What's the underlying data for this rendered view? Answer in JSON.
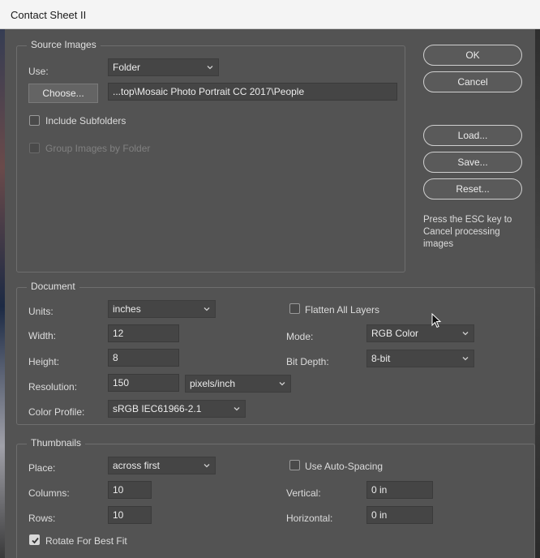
{
  "window": {
    "title": "Contact Sheet II"
  },
  "source_images": {
    "legend": "Source Images",
    "use_label": "Use:",
    "use_value": "Folder",
    "choose_button": "Choose...",
    "path": "...top\\Mosaic Photo Portrait CC 2017\\People",
    "include_subfolders": {
      "label": "Include Subfolders",
      "checked": false
    },
    "group_by_folder": {
      "label": "Group Images by Folder",
      "checked": false,
      "enabled": false
    }
  },
  "buttons": {
    "ok": "OK",
    "cancel": "Cancel",
    "load": "Load...",
    "save": "Save...",
    "reset": "Reset...",
    "note": "Press the ESC key to Cancel processing images"
  },
  "document": {
    "legend": "Document",
    "units_label": "Units:",
    "units_value": "inches",
    "flatten": {
      "label": "Flatten All Layers",
      "checked": false
    },
    "width_label": "Width:",
    "width_value": "12",
    "height_label": "Height:",
    "height_value": "8",
    "resolution_label": "Resolution:",
    "resolution_value": "150",
    "resolution_unit": "pixels/inch",
    "mode_label": "Mode:",
    "mode_value": "RGB Color",
    "bitdepth_label": "Bit Depth:",
    "bitdepth_value": "8-bit",
    "profile_label": "Color Profile:",
    "profile_value": "sRGB IEC61966-2.1"
  },
  "thumbnails": {
    "legend": "Thumbnails",
    "place_label": "Place:",
    "place_value": "across first",
    "columns_label": "Columns:",
    "columns_value": "10",
    "rows_label": "Rows:",
    "rows_value": "10",
    "auto_spacing": {
      "label": "Use Auto-Spacing",
      "checked": false
    },
    "vertical_label": "Vertical:",
    "vertical_value": "0 in",
    "horizontal_label": "Horizontal:",
    "horizontal_value": "0 in",
    "rotate": {
      "label": "Rotate For Best Fit",
      "checked": true
    }
  }
}
